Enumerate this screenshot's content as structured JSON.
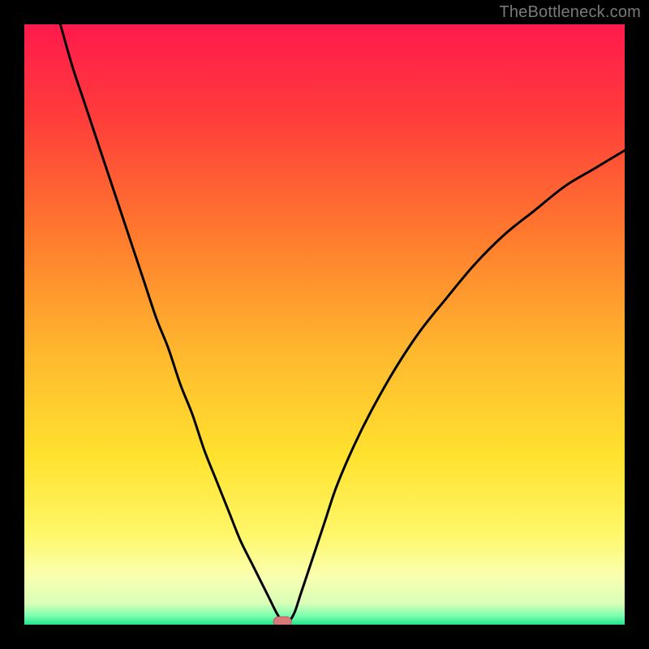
{
  "watermark": "TheBottleneck.com",
  "colors": {
    "frame": "#000000",
    "watermark": "#7a7a7a",
    "curve": "#000000",
    "marker_fill": "#d97a7a",
    "marker_stroke": "#b85c5c",
    "gradient_stops": [
      {
        "offset": 0.0,
        "color": "#ff1a4d"
      },
      {
        "offset": 0.15,
        "color": "#ff3b3b"
      },
      {
        "offset": 0.35,
        "color": "#ff7a2e"
      },
      {
        "offset": 0.55,
        "color": "#ffb92e"
      },
      {
        "offset": 0.72,
        "color": "#ffe22e"
      },
      {
        "offset": 0.85,
        "color": "#fff76a"
      },
      {
        "offset": 0.92,
        "color": "#faffb0"
      },
      {
        "offset": 0.965,
        "color": "#d8ffb8"
      },
      {
        "offset": 0.985,
        "color": "#7cffb0"
      },
      {
        "offset": 1.0,
        "color": "#21e38a"
      }
    ]
  },
  "chart_data": {
    "type": "line",
    "title": "",
    "xlabel": "",
    "ylabel": "",
    "xlim": [
      0,
      100
    ],
    "ylim": [
      0,
      100
    ],
    "optimum_x": 43,
    "series": [
      {
        "name": "bottleneck-curve",
        "x": [
          6,
          8,
          10,
          12,
          14,
          16,
          18,
          20,
          22,
          24,
          26,
          28,
          30,
          32,
          34,
          36,
          38,
          40,
          41,
          42,
          43,
          44,
          45,
          46,
          48,
          50,
          52,
          55,
          58,
          62,
          66,
          70,
          75,
          80,
          85,
          90,
          95,
          100
        ],
        "y": [
          100,
          93,
          87,
          81,
          75,
          69,
          63,
          57,
          51,
          46,
          40,
          35,
          29,
          24,
          19,
          14,
          10,
          6,
          4,
          2,
          0.5,
          0.5,
          2,
          5,
          11,
          17,
          23,
          30,
          36,
          43,
          49,
          54,
          60,
          65,
          69,
          73,
          76,
          79
        ]
      }
    ],
    "marker": {
      "x": 43,
      "y": 0.5
    }
  }
}
